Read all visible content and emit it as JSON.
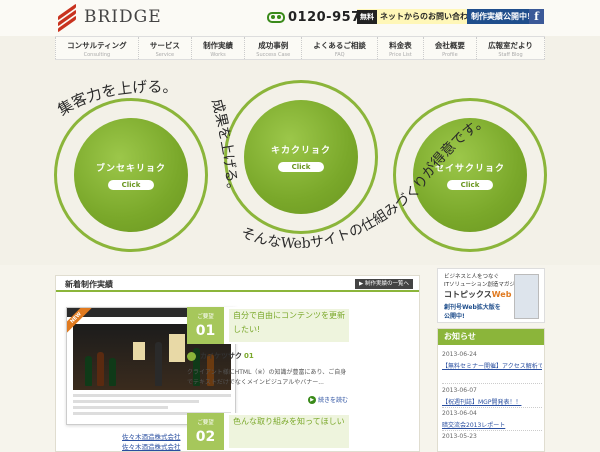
{
  "header": {
    "logo_text": "BRIDGE",
    "phone": "0120-957-593",
    "contact": {
      "tag": "無料",
      "label": "ネットからのお問い合わせ"
    },
    "open_button": "制作実績公開中!",
    "facebook": "f"
  },
  "nav": {
    "items": [
      {
        "ja": "コンサルティング",
        "en": "Consulting"
      },
      {
        "ja": "サービス",
        "en": "Service"
      },
      {
        "ja": "制作実績",
        "en": "Works"
      },
      {
        "ja": "成功事例",
        "en": "Success Case"
      },
      {
        "ja": "よくあるご相談",
        "en": "FAQ"
      },
      {
        "ja": "料金表",
        "en": "Price List"
      },
      {
        "ja": "会社概要",
        "en": "Profile"
      },
      {
        "ja": "広報室だより",
        "en": "Staff Blog"
      }
    ]
  },
  "hero": {
    "circles": [
      {
        "title": "ブンセキリョク",
        "click": "Click"
      },
      {
        "title": "キカクリョク",
        "click": "Click"
      },
      {
        "title": "セイサクリョク",
        "click": "Click"
      }
    ],
    "arc_text_1": "集客力を上げる。",
    "arc_text_2": "成果を上げる。",
    "arc_text_3": "そんなWebサイトの仕組みづくりが得意です。"
  },
  "works": {
    "title": "新着制作実績",
    "all_button": "▶ 制作実績の一覧へ",
    "thumb_bar": "佐々木酒造株式会社",
    "new_ribbon": "NEW",
    "clients": [
      "佐々木酒造株式会社",
      "佐々木酒造株式会社"
    ],
    "requests": [
      {
        "label": "ご要望",
        "num": "01",
        "text": "自分で自由にコンテンツを更新したい!"
      },
      {
        "label": "ご要望",
        "num": "02",
        "text": "色んな取り組みを知ってほしい"
      }
    ],
    "solution_head": "カイケツサク",
    "solution_num": "01",
    "solution_desc": "クライアント様にHTML（※）の知識が豊富にあり、ご自身でテキストだけでなくメインビジュアルやバナー...",
    "more": "続きを読む"
  },
  "sidebar": {
    "ad": {
      "line1": "ビジネスと人をつなぐ",
      "line2": "ITソリューション創造マガジン",
      "title": "コトピックス",
      "title_web": "Web",
      "line3": "創刊号Web拡大版を",
      "line4": "公開中!"
    },
    "news_title": "お知らせ",
    "news": [
      {
        "date": "2013-06-24",
        "title": "【無料セミナー開催】アクセス解析で売上につなげるサイト改善"
      },
      {
        "date": "2013-06-07",
        "title": "【祝週刊誌】MGP開発表！！"
      },
      {
        "date": "2013-06-04",
        "title": "暗交流会2013レポート"
      },
      {
        "date": "2013-05-23",
        "title": ""
      }
    ]
  },
  "colors": {
    "accent": "#8bb53a",
    "brand_red": "#c8321e",
    "link": "#2a4fa0"
  }
}
